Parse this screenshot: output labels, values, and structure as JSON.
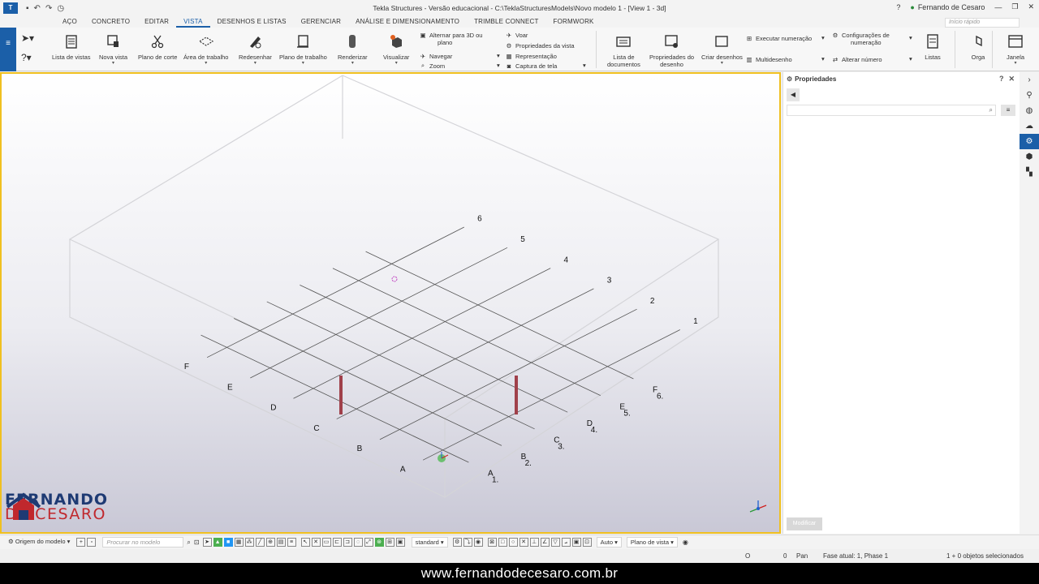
{
  "titlebar": {
    "title": "Tekla Structures - Versão educacional - C:\\TeklaStructuresModels\\Novo modelo 1 - [View 1 - 3d]",
    "user": "Fernando de Cesaro",
    "quick_launch_placeholder": "Início rápido"
  },
  "menu_tabs": [
    "AÇO",
    "CONCRETO",
    "EDITAR",
    "VISTA",
    "DESENHOS E LISTAS",
    "GERENCIAR",
    "ANÁLISE E DIMENSIONAMENTO",
    "TRIMBLE CONNECT",
    "FORMWORK"
  ],
  "menu_active": "VISTA",
  "ribbon": {
    "lista_vistas": "Lista de vistas",
    "nova_vista": "Nova vista",
    "plano_corte": "Plano de corte",
    "area_trabalho": "Área de trabalho",
    "redesenhar": "Redesenhar",
    "plano_trabalho": "Plano de trabalho",
    "renderizar": "Renderizar",
    "visualizar": "Visualizar",
    "alternar_3d": "Alternar para 3D ou",
    "alternar_3d_2": "plano",
    "navegar": "Navegar",
    "zoom": "Zoom",
    "voar": "Voar",
    "propriedades_vista": "Propriedades da vista",
    "representacao": "Representação",
    "captura_tela": "Captura de tela",
    "lista_documentos_1": "Lista de",
    "lista_documentos_2": "documentos",
    "propriedades_desenho_1": "Propriedades do",
    "propriedades_desenho_2": "desenho",
    "criar_desenhos": "Criar desenhos",
    "executar_numeracao": "Executar numeração",
    "multidesenho": "Multidesenho",
    "config_numeracao_1": "Configurações de",
    "config_numeracao_2": "numeração",
    "alterar_numero": "Alterar número",
    "listas": "Listas",
    "orga": "Orga",
    "janela": "Janela"
  },
  "viewport": {
    "grid_labels_left": [
      "1",
      "2",
      "3",
      "4",
      "5",
      "6"
    ],
    "grid_labels_right": [
      "A",
      "B",
      "C",
      "D",
      "E",
      "F"
    ],
    "grid_labels_front_letters": [
      "A",
      "B",
      "C",
      "D",
      "E",
      "F"
    ],
    "grid_labels_front_numbers": [
      "1.",
      "2.",
      "3.",
      "4.",
      "5.",
      "6."
    ]
  },
  "brand": {
    "line1": "FERNANDO",
    "line2": "DE CESARO"
  },
  "properties": {
    "title": "Propriedades",
    "modify_button": "Modificar"
  },
  "bottom_toolbar": {
    "origin": "Origem do modelo",
    "search_placeholder": "Procurar no modelo",
    "standard": "standard",
    "auto": "Auto",
    "plane": "Plano de vista"
  },
  "status": {
    "o_label": "O",
    "zero": "0",
    "pan": "Pan",
    "phase": "Fase atual: 1, Phase 1",
    "selected": "1 + 0 objetos selecionados"
  },
  "footer": {
    "url": "www.fernandodecesaro.com.br"
  },
  "colors": {
    "accent": "#1b5fa8",
    "viewport_border": "#f0c020",
    "column": "#a0404a",
    "brand_blue": "#1e3a73",
    "brand_red": "#c0282d"
  }
}
